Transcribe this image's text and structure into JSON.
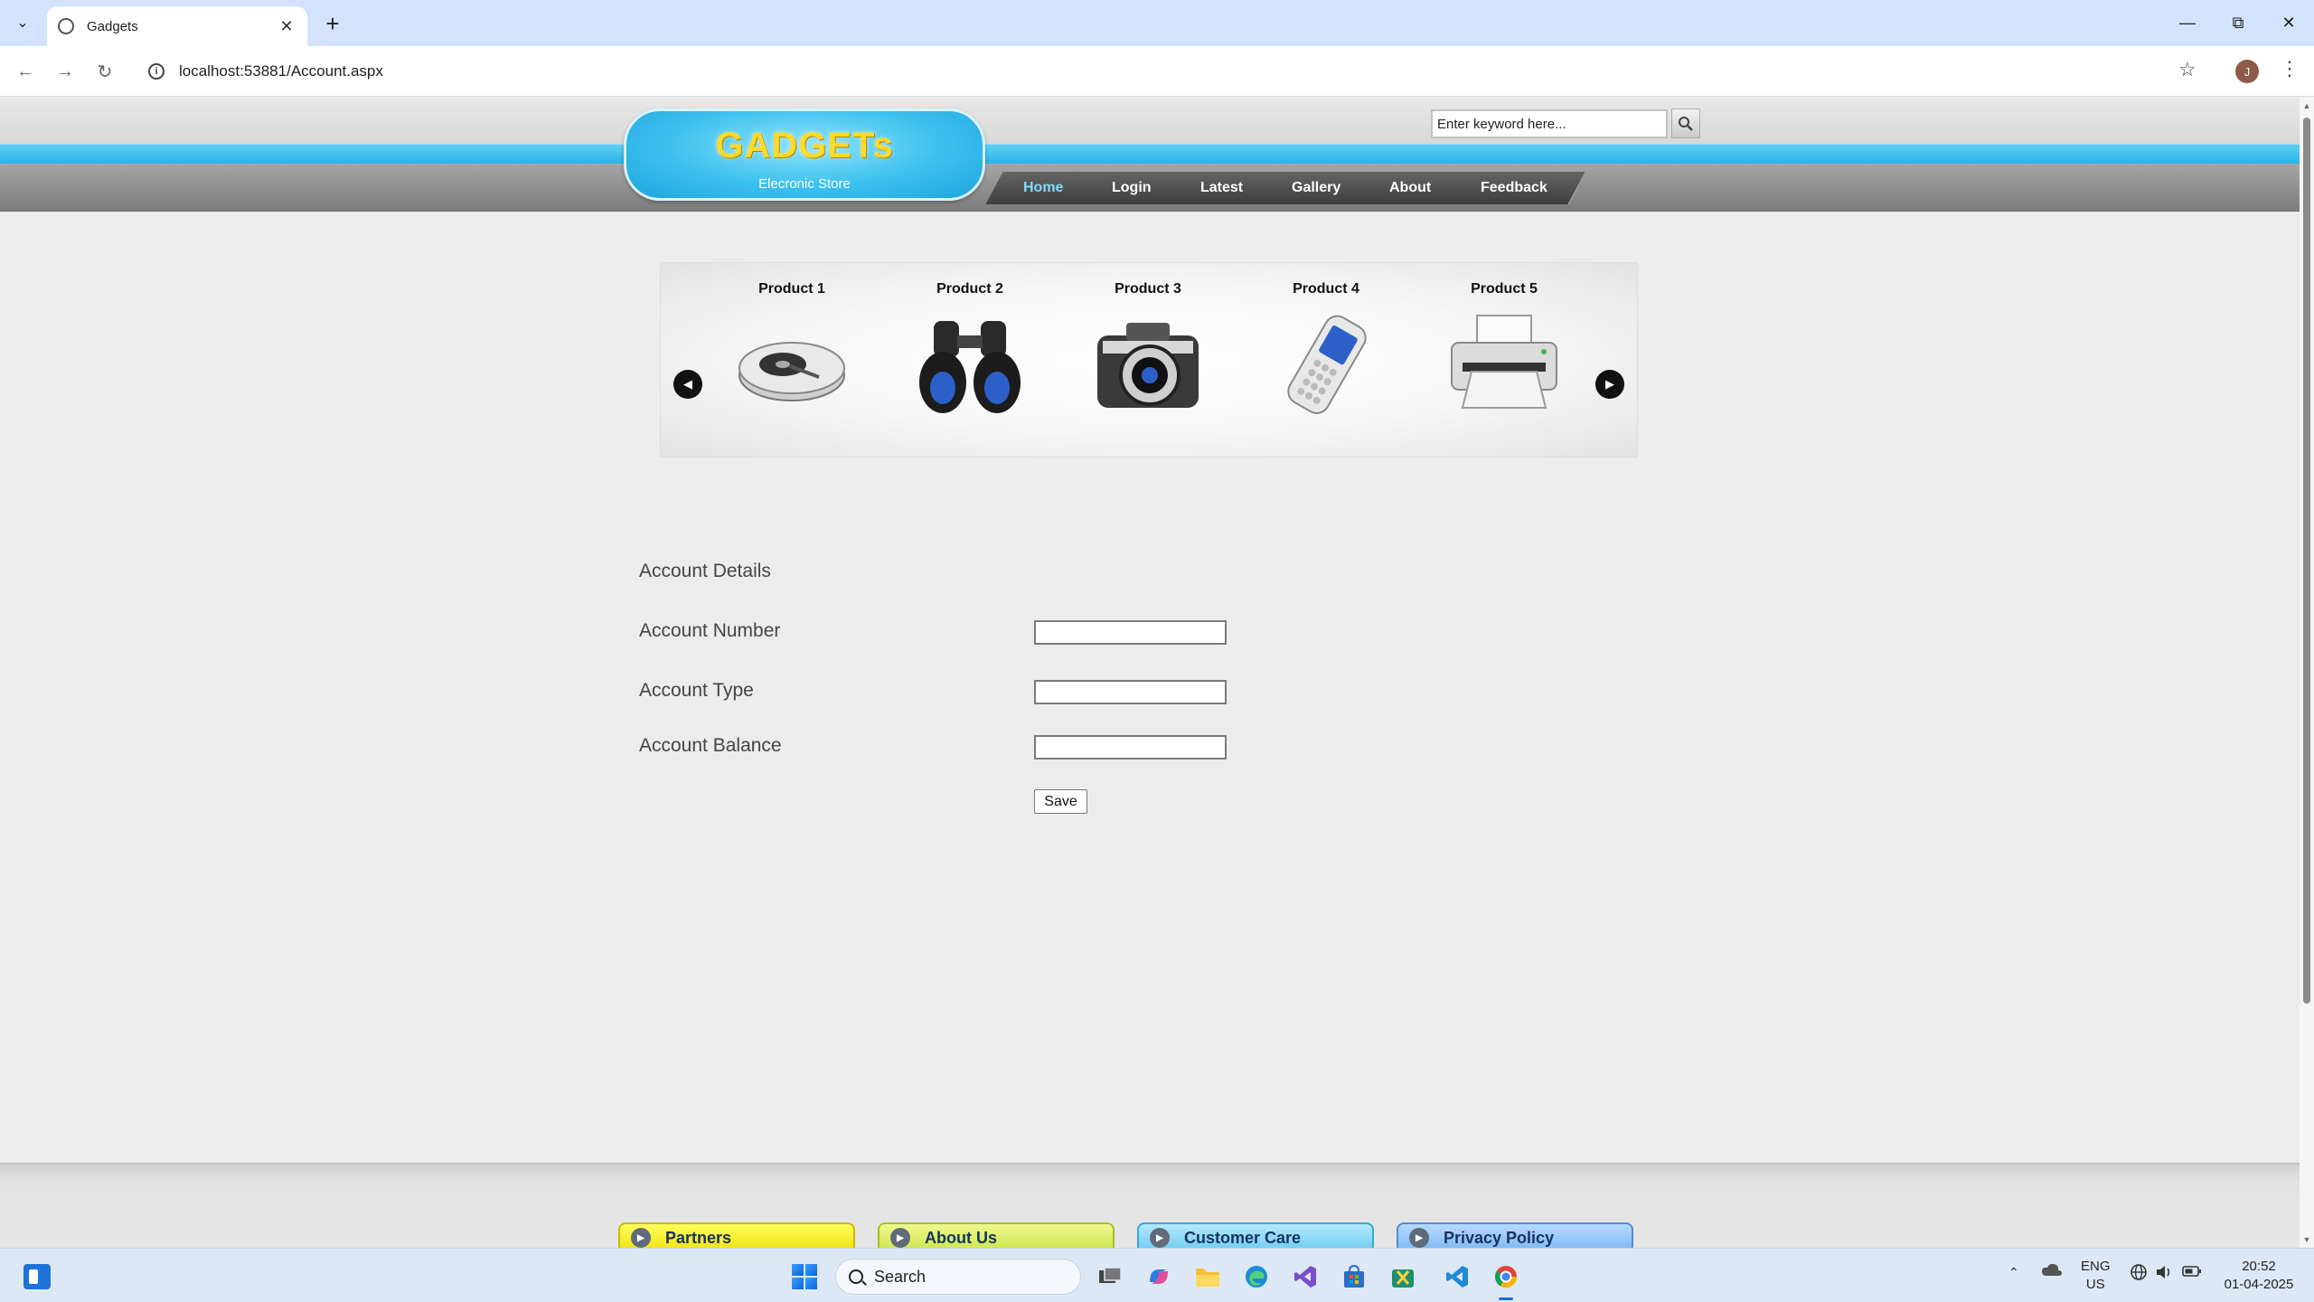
{
  "browser": {
    "tab_title": "Gadgets",
    "url": "localhost:53881/Account.aspx",
    "profile_initial": "J"
  },
  "site": {
    "logo_title": "GADGETs",
    "logo_subtitle": "Elecronic Store",
    "search_placeholder": "Enter keyword here...",
    "nav": [
      "Home",
      "Login",
      "Latest",
      "Gallery",
      "About",
      "Feedback"
    ],
    "active_nav": "Home"
  },
  "products": [
    {
      "name": "Product 1",
      "icon": "hard-drive-icon"
    },
    {
      "name": "Product 2",
      "icon": "binoculars-icon"
    },
    {
      "name": "Product 3",
      "icon": "camera-icon"
    },
    {
      "name": "Product 4",
      "icon": "mobile-phone-icon"
    },
    {
      "name": "Product 5",
      "icon": "printer-icon"
    }
  ],
  "form": {
    "heading": "Account Details",
    "fields": [
      {
        "label": "Account Number",
        "value": ""
      },
      {
        "label": "Account Type",
        "value": ""
      },
      {
        "label": "Account Balance",
        "value": ""
      }
    ],
    "save_label": "Save"
  },
  "footer": {
    "links": [
      "Partners",
      "About Us",
      "Customer Care",
      "Privacy Policy"
    ]
  },
  "taskbar": {
    "search_label": "Search",
    "lang_line1": "ENG",
    "lang_line2": "US",
    "time": "20:52",
    "date": "01-04-2025"
  },
  "colors": {
    "header_blue": "#29b2e6",
    "logo_text": "#ffd92b",
    "nav_active": "#7fdcff",
    "footer_link": "#163360"
  }
}
